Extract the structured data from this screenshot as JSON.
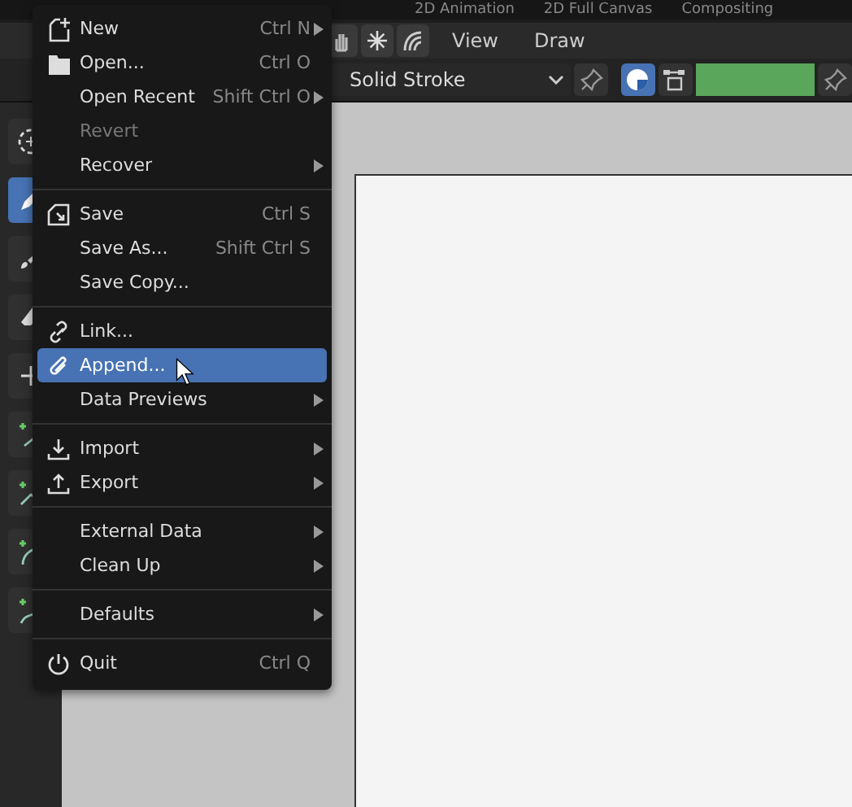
{
  "workspace_tabs": [
    {
      "label": "2D Animation",
      "selected": false
    },
    {
      "label": "2D Full Canvas",
      "selected": false
    },
    {
      "label": "Compositing",
      "selected": false
    }
  ],
  "header": {
    "menus": [
      "View",
      "Draw"
    ]
  },
  "tool_settings": {
    "material": "Solid Stroke",
    "sphere_toggle_on": true
  },
  "file_menu": {
    "groups": [
      [
        {
          "label": "New",
          "shortcut": "Ctrl N",
          "submenu": true,
          "disabled": false,
          "selected": false
        },
        {
          "label": "Open...",
          "shortcut": "Ctrl O",
          "submenu": false,
          "disabled": false,
          "selected": false
        },
        {
          "label": "Open Recent",
          "shortcut": "Shift Ctrl O",
          "submenu": true,
          "disabled": false,
          "selected": false
        },
        {
          "label": "Revert",
          "submenu": false,
          "disabled": true,
          "selected": false
        },
        {
          "label": "Recover",
          "submenu": true,
          "disabled": false,
          "selected": false
        }
      ],
      [
        {
          "label": "Save",
          "shortcut": "Ctrl S",
          "submenu": false,
          "disabled": false,
          "selected": false
        },
        {
          "label": "Save As...",
          "shortcut": "Shift Ctrl S",
          "submenu": false,
          "disabled": false,
          "selected": false
        },
        {
          "label": "Save Copy...",
          "submenu": false,
          "disabled": false,
          "selected": false
        }
      ],
      [
        {
          "label": "Link...",
          "submenu": false,
          "disabled": false,
          "selected": false
        },
        {
          "label": "Append...",
          "submenu": false,
          "disabled": false,
          "selected": true
        },
        {
          "label": "Data Previews",
          "submenu": true,
          "disabled": false,
          "selected": false
        }
      ],
      [
        {
          "label": "Import",
          "submenu": true,
          "disabled": false,
          "selected": false
        },
        {
          "label": "Export",
          "submenu": true,
          "disabled": false,
          "selected": false
        }
      ],
      [
        {
          "label": "External Data",
          "submenu": true,
          "disabled": false,
          "selected": false
        },
        {
          "label": "Clean Up",
          "submenu": true,
          "disabled": false,
          "selected": false
        }
      ],
      [
        {
          "label": "Defaults",
          "submenu": true,
          "disabled": false,
          "selected": false
        }
      ],
      [
        {
          "label": "Quit",
          "shortcut": "Ctrl Q",
          "submenu": false,
          "disabled": false,
          "selected": false
        }
      ]
    ]
  }
}
